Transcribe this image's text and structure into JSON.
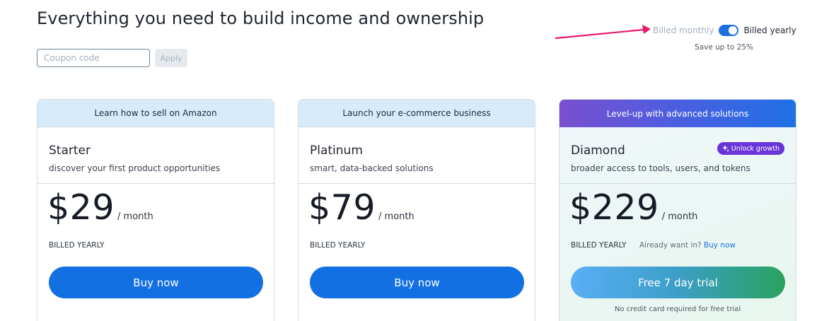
{
  "page": {
    "title": "Everything you need to build income and ownership"
  },
  "coupon": {
    "placeholder": "Coupon code",
    "apply_label": "Apply"
  },
  "billing": {
    "monthly_label": "Billed monthly",
    "yearly_label": "Billed yearly",
    "yearly_selected": true,
    "save_text": "Save up to 25%"
  },
  "colors": {
    "primary": "#1270e3",
    "badge": "#6a35d8",
    "arrow": "#e8196c",
    "header_light": "#d7ebfb"
  },
  "plans": [
    {
      "header": "Learn how to sell on Amazon",
      "name": "Starter",
      "description": "discover your first product opportunities",
      "price": "$29",
      "per": "/ month",
      "billed": "BILLED YEARLY",
      "button": "Buy now"
    },
    {
      "header": "Launch your e-commerce business",
      "name": "Platinum",
      "description": "smart, data-backed solutions",
      "price": "$79",
      "per": "/ month",
      "billed": "BILLED YEARLY",
      "button": "Buy now"
    },
    {
      "header": "Level-up with advanced solutions",
      "name": "Diamond",
      "badge_icon": "sparkle-icon",
      "badge": "Unlock growth",
      "description": "broader access to tools, users, and tokens",
      "price": "$229",
      "per": "/ month",
      "billed": "BILLED YEARLY",
      "already_text": "Already want in?",
      "already_link": "Buy now",
      "button": "Free 7 day trial",
      "note": "No credit card required for free trial"
    }
  ]
}
